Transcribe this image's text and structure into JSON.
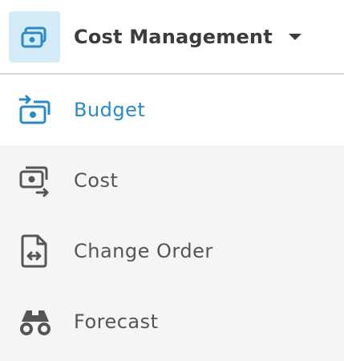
{
  "header": {
    "title": "Cost Management",
    "icon": "money-icon",
    "dropdown_icon": "caret-down-icon"
  },
  "menu": {
    "items": [
      {
        "label": "Budget",
        "icon": "budget-icon",
        "active": true
      },
      {
        "label": "Cost",
        "icon": "cost-icon",
        "active": false
      },
      {
        "label": "Change Order",
        "icon": "change-order-icon",
        "active": false
      },
      {
        "label": "Forecast",
        "icon": "binoculars-icon",
        "active": false
      }
    ]
  },
  "colors": {
    "accent": "#2a8ac7",
    "header_icon_bg": "#d4ecf8",
    "text": "#555555",
    "title": "#3c3c3c",
    "background": "#f5f5f5"
  }
}
